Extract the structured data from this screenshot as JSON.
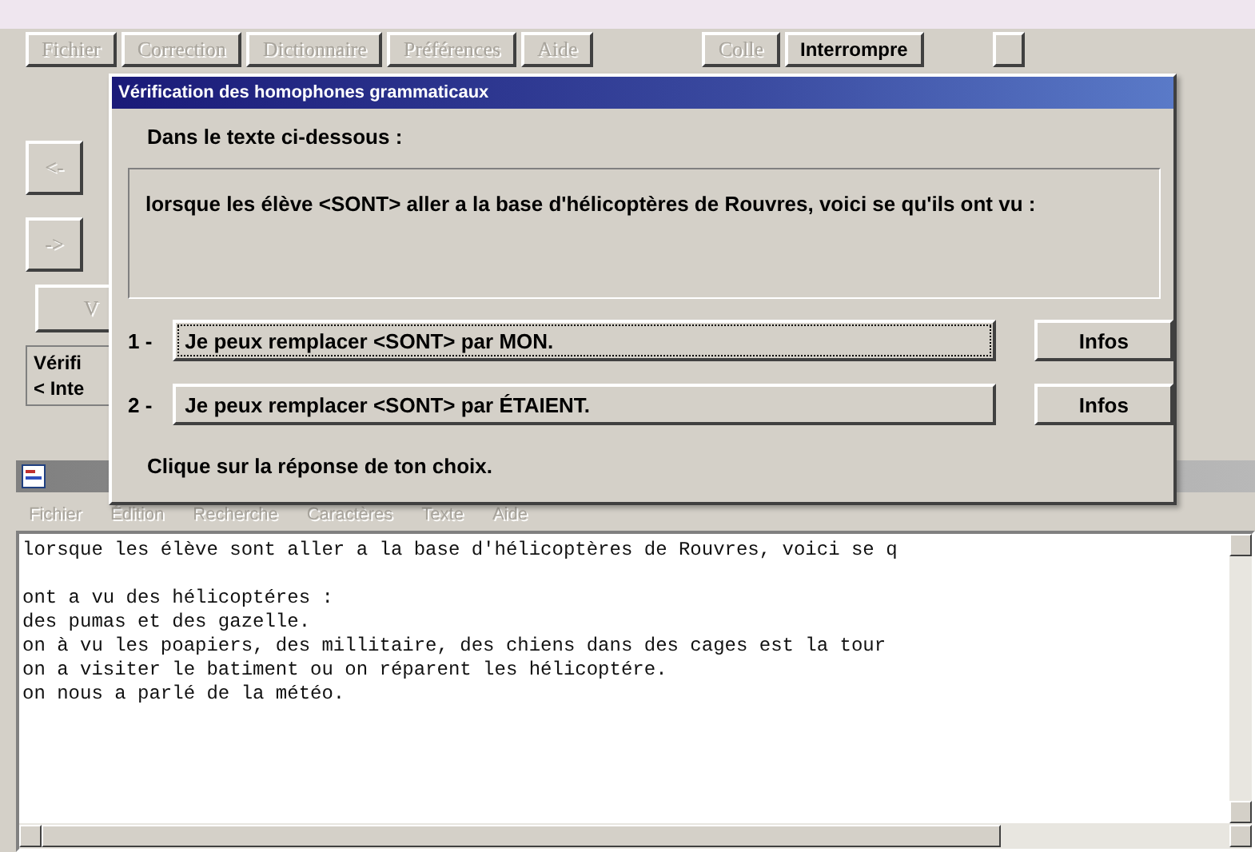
{
  "menu_bar": {
    "items": [
      {
        "label": "Fichier",
        "disabled": true
      },
      {
        "label": "Correction",
        "disabled": true
      },
      {
        "label": "Dictionnaire",
        "disabled": true
      },
      {
        "label": "Préférences",
        "disabled": true
      },
      {
        "label": "Aide",
        "disabled": true
      }
    ],
    "actions": [
      {
        "label": "Colle",
        "disabled": true
      },
      {
        "label": "Interrompre",
        "disabled": false
      }
    ]
  },
  "side_buttons": [
    {
      "label": "<-",
      "disabled": true
    },
    {
      "label": "->",
      "disabled": true
    }
  ],
  "hidden_button": {
    "label": "V"
  },
  "status_lines": [
    "Vérifi",
    "< Inte"
  ],
  "dialog": {
    "title": "Vérification des homophones grammaticaux",
    "intro": "Dans le texte ci-dessous :",
    "excerpt": "lorsque les élève <SONT> aller a la base d'hélicoptères de Rouvres, voici se qu'ils ont vu :",
    "choices": [
      {
        "number": "1 -",
        "label": "Je peux remplacer <SONT> par MON.",
        "focused": true,
        "info": "Infos"
      },
      {
        "number": "2 -",
        "label": "Je peux remplacer <SONT> par ÉTAIENT.",
        "focused": false,
        "info": "Infos"
      }
    ],
    "footer": "Clique sur la réponse de ton choix."
  },
  "editor": {
    "menu": [
      "Fichier",
      "Édition",
      "Recherche",
      "Caractères",
      "Texte",
      "Aide"
    ],
    "paragraphs": [
      [
        "lorsque les élève sont aller a la base d'hélicoptères de Rouvres, voici se q"
      ],
      [
        "ont a vu des hélicoptéres :",
        "des pumas et des gazelle.",
        "on à vu les poapiers, des millitaire, des chiens dans des cages est la tour",
        "on a visiter le batiment ou on réparent les hélicoptére.",
        "on nous a parlé de la météo."
      ]
    ]
  }
}
